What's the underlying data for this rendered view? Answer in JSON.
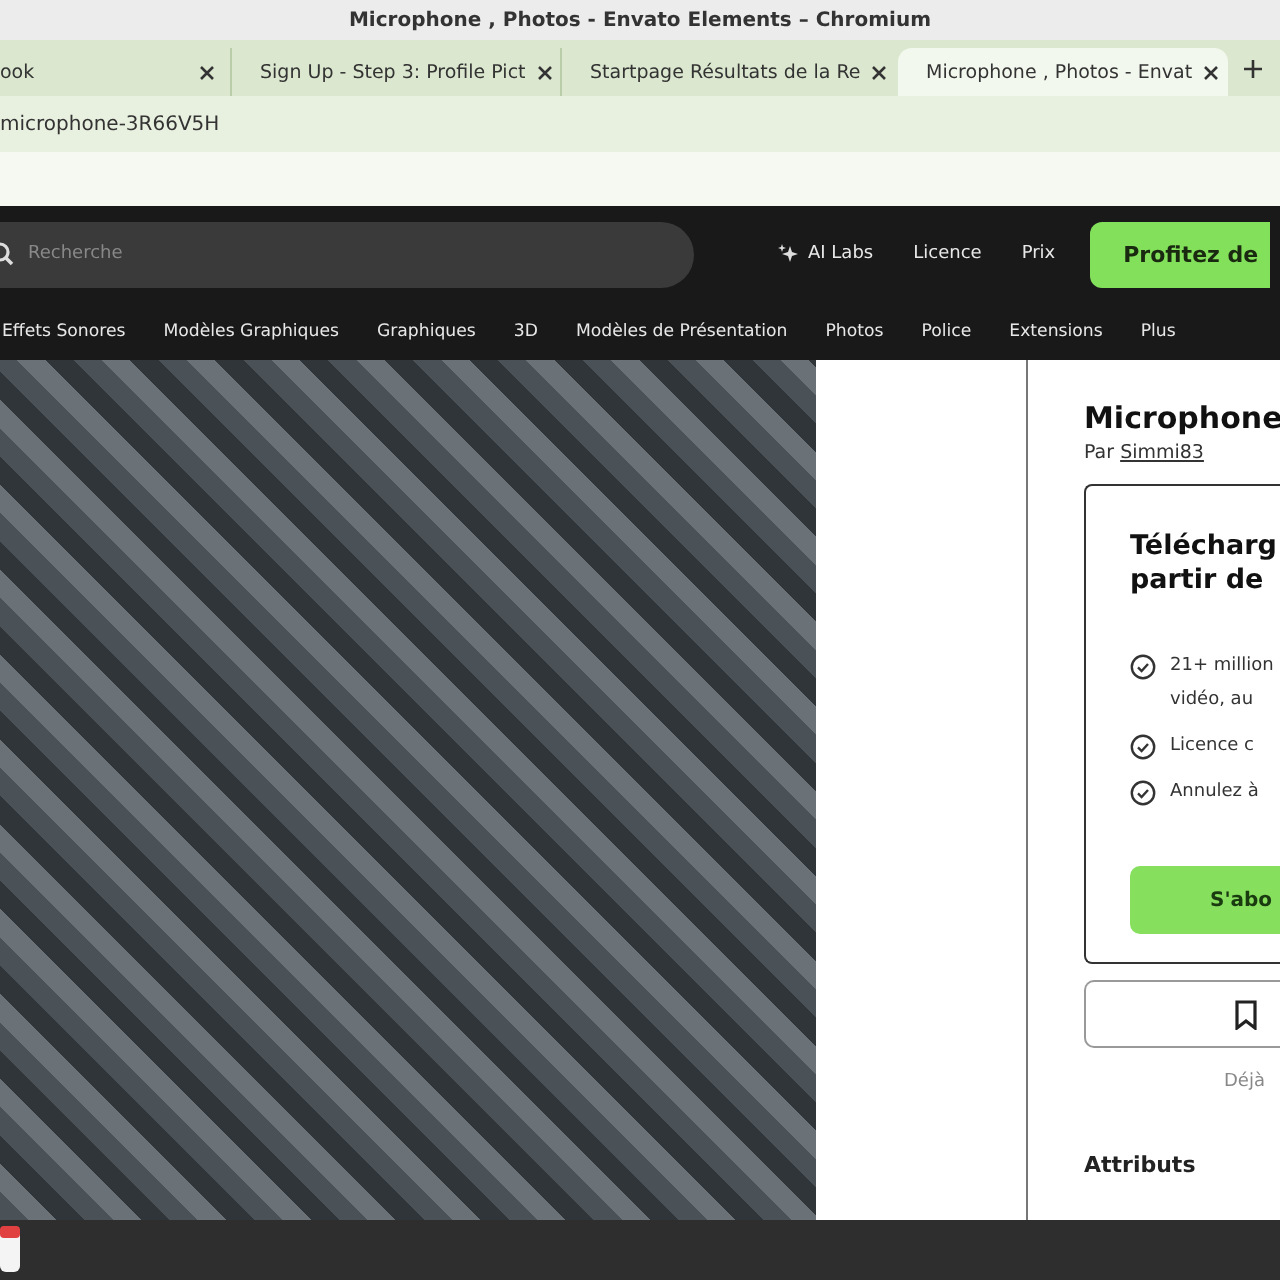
{
  "window": {
    "title": "Microphone , Photos - Envato Elements – Chromium"
  },
  "tabs": [
    {
      "title": "ook",
      "selected": false
    },
    {
      "title": "Sign Up - Step 3: Profile Pict",
      "selected": false
    },
    {
      "title": "Startpage Résultats de la Re",
      "selected": false
    },
    {
      "title": "Microphone , Photos - Envat",
      "selected": true
    }
  ],
  "address_bar": {
    "value": "microphone-3R66V5H"
  },
  "header": {
    "search": {
      "placeholder": "Recherche"
    },
    "links": [
      "AI Labs",
      "Licence",
      "Prix"
    ],
    "cta": "Profitez de"
  },
  "nav": [
    "Effets Sonores",
    "Modèles Graphiques",
    "Graphiques",
    "3D",
    "Modèles de Présentation",
    "Photos",
    "Police",
    "Extensions",
    "Plus"
  ],
  "item": {
    "title": "Microphone",
    "by": "Par",
    "author": "Simmi83",
    "card": {
      "heading": [
        "Télécharg",
        "partir de"
      ],
      "features": [
        {
          "lines": [
            "21+ million",
            "vidéo, au"
          ]
        },
        {
          "lines": [
            "Licence c"
          ]
        },
        {
          "lines": [
            "Annulez à"
          ]
        }
      ],
      "button": "S'abo"
    },
    "signin": "Déjà",
    "attributes": "Attributs"
  }
}
